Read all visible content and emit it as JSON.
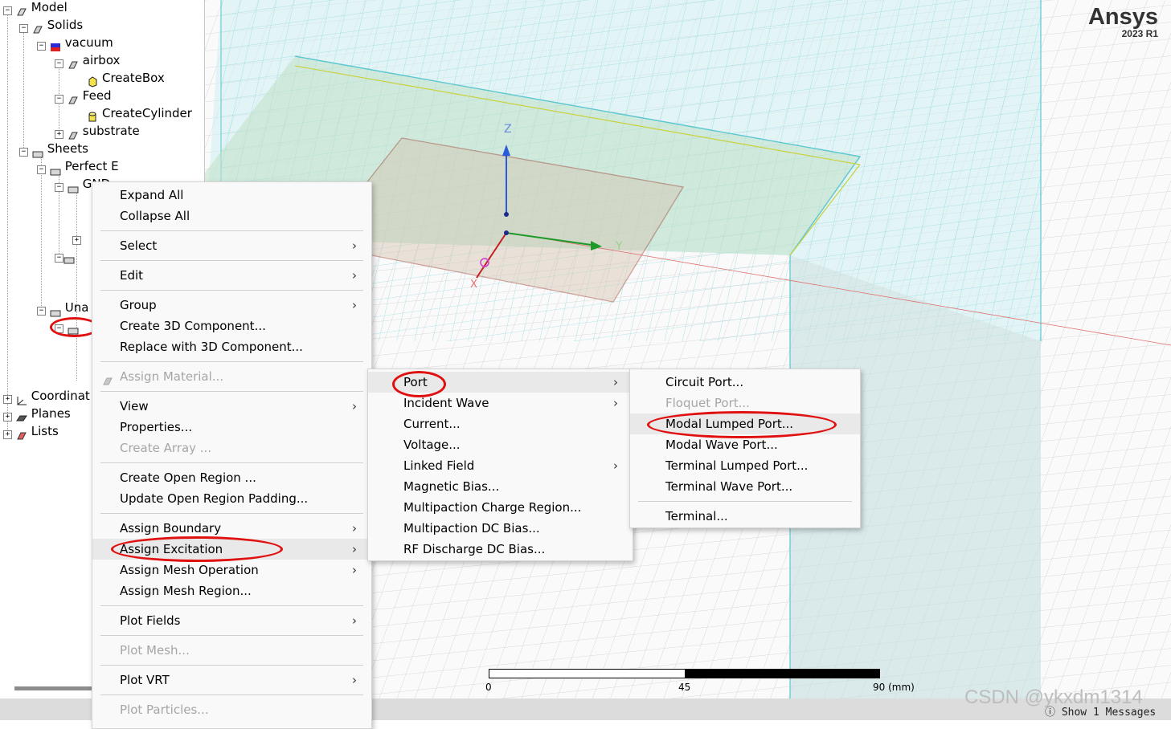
{
  "tree": {
    "items": [
      {
        "label": "Model",
        "icon": "model-icon"
      },
      {
        "label": "Solids",
        "icon": "solids-icon"
      },
      {
        "label": "vacuum",
        "icon": "material-icon"
      },
      {
        "label": "airbox",
        "icon": "solid-object-icon"
      },
      {
        "label": "CreateBox",
        "icon": "create-box-icon"
      },
      {
        "label": "Feed",
        "icon": "solid-object-icon"
      },
      {
        "label": "CreateCylinder",
        "icon": "create-cylinder-icon"
      },
      {
        "label": "substrate",
        "icon": "solid-object-icon"
      },
      {
        "label": "Sheets",
        "icon": "sheets-icon"
      },
      {
        "label": "Perfect E",
        "icon": "sheet-group-icon"
      },
      {
        "label": "GND",
        "icon": "sheet-object-icon"
      },
      {
        "label": "Una",
        "icon": "sheet-group-icon"
      },
      {
        "label": "Coordinat",
        "icon": "coordinate-systems-icon"
      },
      {
        "label": "Planes",
        "icon": "planes-icon"
      },
      {
        "label": "Lists",
        "icon": "lists-icon"
      }
    ]
  },
  "logo": {
    "brand": "Ansys",
    "version": "2023 R1"
  },
  "viewport": {
    "axis_z": "Z",
    "axis_y": "Y",
    "axis_x": "X",
    "scale_ticks": [
      "0",
      "45",
      "90 (mm)"
    ]
  },
  "context_menu": {
    "items": [
      {
        "label": "Expand All",
        "submenu": false,
        "disabled": false
      },
      {
        "label": "Collapse All",
        "submenu": false,
        "disabled": false
      },
      {
        "label": "Select",
        "submenu": true,
        "disabled": false
      },
      {
        "label": "Edit",
        "submenu": true,
        "disabled": false
      },
      {
        "label": "Group",
        "submenu": true,
        "disabled": false
      },
      {
        "label": "Create 3D Component...",
        "submenu": false,
        "disabled": false
      },
      {
        "label": "Replace with 3D Component...",
        "submenu": false,
        "disabled": false
      },
      {
        "label": "Assign Material...",
        "submenu": false,
        "disabled": true
      },
      {
        "label": "View",
        "submenu": true,
        "disabled": false
      },
      {
        "label": "Properties...",
        "submenu": false,
        "disabled": false
      },
      {
        "label": "Create Array ...",
        "submenu": false,
        "disabled": true
      },
      {
        "label": "Create Open Region ...",
        "submenu": false,
        "disabled": false
      },
      {
        "label": "Update Open Region Padding...",
        "submenu": false,
        "disabled": false
      },
      {
        "label": "Assign Boundary",
        "submenu": true,
        "disabled": false
      },
      {
        "label": "Assign Excitation",
        "submenu": true,
        "disabled": false
      },
      {
        "label": "Assign Mesh Operation",
        "submenu": true,
        "disabled": false
      },
      {
        "label": "Assign Mesh Region...",
        "submenu": false,
        "disabled": false
      },
      {
        "label": "Plot Fields",
        "submenu": true,
        "disabled": false
      },
      {
        "label": "Plot Mesh...",
        "submenu": false,
        "disabled": true
      },
      {
        "label": "Plot VRT",
        "submenu": true,
        "disabled": false
      },
      {
        "label": "Plot Particles...",
        "submenu": false,
        "disabled": true
      }
    ]
  },
  "excitation_menu": {
    "items": [
      {
        "label": "Port",
        "submenu": true
      },
      {
        "label": "Incident Wave",
        "submenu": true
      },
      {
        "label": "Current...",
        "submenu": false
      },
      {
        "label": "Voltage...",
        "submenu": false
      },
      {
        "label": "Linked Field",
        "submenu": true
      },
      {
        "label": "Magnetic Bias...",
        "submenu": false
      },
      {
        "label": "Multipaction Charge Region...",
        "submenu": false
      },
      {
        "label": "Multipaction DC Bias...",
        "submenu": false
      },
      {
        "label": "RF Discharge DC Bias...",
        "submenu": false
      }
    ]
  },
  "port_menu": {
    "items": [
      {
        "label": "Circuit Port...",
        "disabled": false
      },
      {
        "label": "Floquet Port...",
        "disabled": true
      },
      {
        "label": "Modal Lumped Port...",
        "disabled": false
      },
      {
        "label": "Modal Wave Port...",
        "disabled": false
      },
      {
        "label": "Terminal Lumped Port...",
        "disabled": false
      },
      {
        "label": "Terminal Wave Port...",
        "disabled": false
      },
      {
        "label": "Terminal...",
        "disabled": false
      }
    ]
  },
  "status": {
    "watermark": "CSDN @ykxdm1314",
    "messages_button": "Show 1 Messages"
  },
  "colors": {
    "highlight_ring": "#e01010",
    "grid": "#7fd3dc"
  }
}
